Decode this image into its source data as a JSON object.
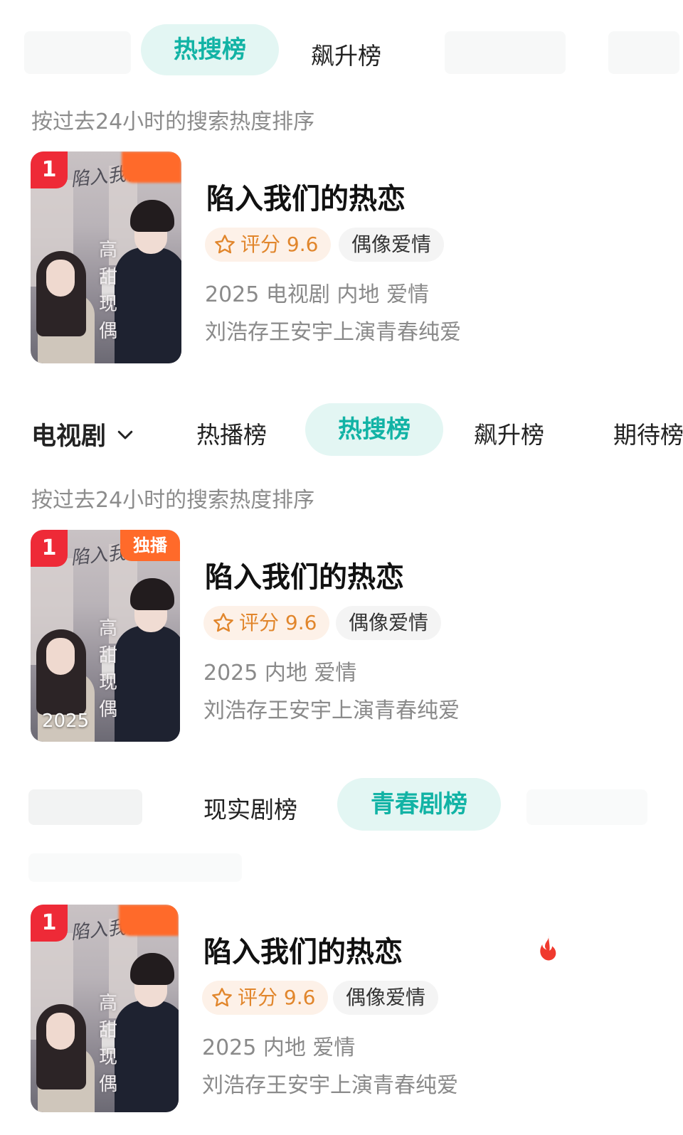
{
  "section1": {
    "tabs": [
      {
        "label": "热搜榜",
        "active": true
      },
      {
        "label": "飙升榜",
        "active": false
      }
    ],
    "subtitle": "按过去24小时的搜索热度排序",
    "card": {
      "rank": "1",
      "title": "陷入我们的热恋",
      "score_label": "评分 9.6",
      "genre_tag": "偶像爱情",
      "meta": "2025 电视剧 内地 爱情",
      "desc": "刘浩存王安宇上演青春纯爱",
      "poster_text": "高甜现偶"
    }
  },
  "section2": {
    "category": "电视剧",
    "tabs": [
      {
        "label": "热播榜",
        "active": false
      },
      {
        "label": "热搜榜",
        "active": true
      },
      {
        "label": "飙升榜",
        "active": false
      },
      {
        "label": "期待榜",
        "active": false
      }
    ],
    "subtitle": "按过去24小时的搜索热度排序",
    "card": {
      "rank": "1",
      "ribbon": "独播",
      "title": "陷入我们的热恋",
      "score_label": "评分 9.6",
      "genre_tag": "偶像爱情",
      "meta": "2025 内地 爱情",
      "desc": "刘浩存王安宇上演青春纯爱",
      "poster_text": "高甜现偶",
      "poster_year": "2025"
    }
  },
  "section3": {
    "tabs": [
      {
        "label": "现实剧榜",
        "active": false
      },
      {
        "label": "青春剧榜",
        "active": true
      }
    ],
    "card": {
      "rank": "1",
      "title": "陷入我们的热恋",
      "score_label": "评分 9.6",
      "genre_tag": "偶像爱情",
      "meta": "2025 内地 爱情",
      "desc": "刘浩存王安宇上演青春纯爱",
      "poster_text": "高甜现偶",
      "hot_icon": "flame-icon"
    }
  },
  "colors": {
    "accent": "#12b3a5",
    "pill_bg": "#e3f6f3",
    "rank_red": "#ee2a37",
    "ribbon_orange": "#ff6a2a",
    "score_orange": "#e1862c",
    "meta_gray": "#8a8a8a"
  }
}
